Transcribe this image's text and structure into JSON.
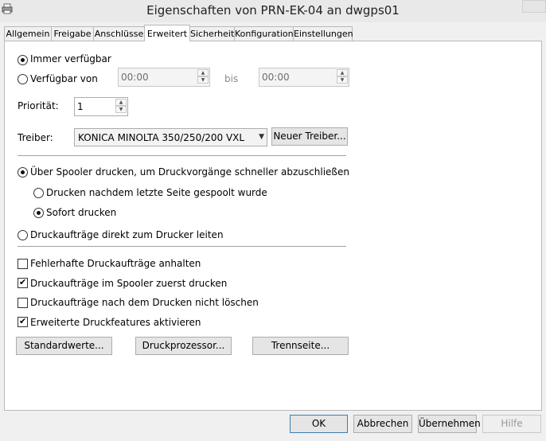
{
  "window": {
    "title": "Eigenschaften von PRN-EK-04 an dwgps01"
  },
  "tabs": [
    "Allgemein",
    "Freigabe",
    "Anschlüsse",
    "Erweitert",
    "Sicherheit",
    "Konfiguration",
    "Einstellungen"
  ],
  "availability": {
    "always_label": "Immer verfügbar",
    "from_label": "Verfügbar von",
    "from_time": "00:00",
    "to_label": "bis",
    "to_time": "00:00",
    "selected": "always"
  },
  "priority": {
    "label": "Priorität:",
    "value": "1"
  },
  "driver": {
    "label": "Treiber:",
    "value": "KONICA MINOLTA 350/250/200 VXL",
    "new_driver_label": "Neuer Treiber..."
  },
  "spooling": {
    "spool_label": "Über Spooler drucken, um Druckvorgänge schneller abzuschließen",
    "after_last_page_label": "Drucken nachdem letzte Seite gespoolt wurde",
    "immediately_label": "Sofort drucken",
    "direct_label": "Druckaufträge direkt zum Drucker leiten"
  },
  "options": {
    "hold_mismatched": {
      "label": "Fehlerhafte Druckaufträge anhalten",
      "checked": false
    },
    "spooled_first": {
      "label": "Druckaufträge im Spooler zuerst drucken",
      "checked": true
    },
    "keep_printed": {
      "label": "Druckaufträge nach dem Drucken nicht löschen",
      "checked": false
    },
    "advanced_features": {
      "label": "Erweiterte Druckfeatures aktivieren",
      "checked": true
    }
  },
  "bottom_buttons": {
    "defaults": "Standardwerte...",
    "processor": "Druckprozessor...",
    "separator": "Trennseite..."
  },
  "dialog_buttons": {
    "ok": "OK",
    "cancel": "Abbrechen",
    "apply": "Übernehmen",
    "help": "Hilfe"
  }
}
